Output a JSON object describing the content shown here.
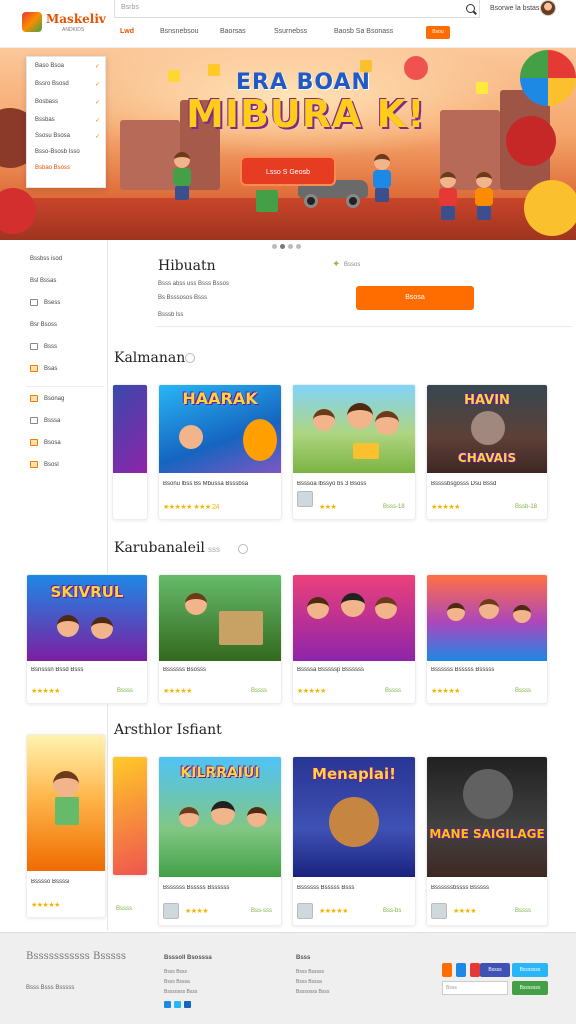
{
  "header": {
    "logo_text": "Maskeliv",
    "logo_sub": "ANDKIDS",
    "search_placeholder": "Bsrbs",
    "signin": "Bsorwe la bstas",
    "nav": [
      {
        "label": "Lwd",
        "active": true
      },
      {
        "label": "Bsnsnebsou",
        "active": false
      },
      {
        "label": "Baorsas",
        "active": false
      },
      {
        "label": "Ssurnebss",
        "active": false
      },
      {
        "label": "Baosb Sa Bsonass",
        "active": false
      }
    ],
    "nav_cta": "Bsou"
  },
  "dropdown": {
    "items": [
      "Baso Bsoa",
      "Bssro Bsosd",
      "Bosbass",
      "Bssbas",
      "Ssosu Bsosa",
      "Bsso-Bsosb Isso",
      "Bsbao Bsoss"
    ],
    "checks": [
      "✓",
      "✓",
      "✓",
      "✓",
      "✓"
    ]
  },
  "hero": {
    "title_line1": "ERA BOAN",
    "title_line2": "MIBURA K!",
    "cta": "Lsso S Geosb"
  },
  "sidebar": {
    "items": [
      "Bssbss isod",
      "Bsl Bssas",
      "Bsess",
      "Bsr Bsoss",
      "Bsss",
      "Bsas",
      "Bsonag",
      "Bsssa",
      "Bsosa",
      "Bsosl"
    ]
  },
  "info": {
    "title": "Hibuatn",
    "tag": "Bssos",
    "lines": [
      "Bsss abss uss Bsss Bssos",
      "Bs Bsssosos Bsss",
      "Bsssb lss"
    ],
    "cta": "Bsosa"
  },
  "sections": [
    {
      "title": "Kalmanan",
      "cards": [
        {
          "title": "",
          "thumb_text": "",
          "stars": "",
          "price": ""
        },
        {
          "title": "Bsonu lbss Bs Mbussa Bsssbsa",
          "thumb_text": "HAARAK",
          "stars": "★★★★★ ★★★ 24",
          "price": "Bssos"
        },
        {
          "title": "Bsssoa lbssyo bs 3 Bsoss",
          "thumb_text": "",
          "stars": "★★★",
          "price": "Bsss-18"
        },
        {
          "title": "Bssssbsgosss Dsu Bssd",
          "thumb_text": "CHAVAIS",
          "stars": "★★★★★",
          "price": "Bssb-18"
        }
      ]
    },
    {
      "title": "Karubanaleil",
      "subtitle": "sss",
      "cards": [
        {
          "title": "Bsnsssn Bssd Bsss",
          "thumb_text": "SKIVRUL",
          "stars": "★★★★★",
          "price": "Bssss"
        },
        {
          "title": "Bssssss Bsosss",
          "thumb_text": "",
          "stars": "★★★★★",
          "price": "Bssss"
        },
        {
          "title": "Bssssa Bsssssp Bssssss",
          "thumb_text": "",
          "stars": "★★★★★",
          "price": "Bssss"
        },
        {
          "title": "Bssssss Bsssss Bsssss",
          "thumb_text": "",
          "stars": "★★★★★",
          "price": "Bssss"
        }
      ]
    },
    {
      "title": "Arsthlor Isfiant",
      "cards": [
        {
          "title": "Bsssso Bssssi",
          "thumb_text": "",
          "stars": "★★★★★",
          "price": "Bssss"
        },
        {
          "title": "Bssssss Bsssss Bssssss",
          "thumb_text": "KILRRAIUI",
          "stars": "★★★★",
          "price": "Bss-sss"
        },
        {
          "title": "Bssssss Bsssss Bsss",
          "thumb_text": "Menaplai!",
          "stars": "★★★★★",
          "price": "Bss-bs"
        },
        {
          "title": "Bssssssbssss Bsssss",
          "thumb_text": "MANE SAIGILAGE",
          "stars": "★★★★",
          "price": "Bssss"
        }
      ]
    }
  ],
  "footer": {
    "brand": "Bsssssssssss Bsssss",
    "copy": "Bsss Bsss Bsssss",
    "cols": [
      {
        "heading": "Bsssoll Bsosssa",
        "links": [
          "Bsss Bsss",
          "Bsss Bsssa",
          "Bsssosss Bsss"
        ]
      },
      {
        "heading": "Bsss",
        "links": [
          "Bsss Bsssss",
          "Bsss Bsssa",
          "Bsssosss Bsss"
        ]
      }
    ],
    "subscribe_btn": "Bssss",
    "subscribe_btn2": "Bsssssss",
    "email_placeholder": "Bsss",
    "submit": "Bsssssss"
  },
  "colors": {
    "accent": "#ff6d00",
    "brand": "#e65100",
    "stars": "#f4b400",
    "price": "#7cb342"
  }
}
